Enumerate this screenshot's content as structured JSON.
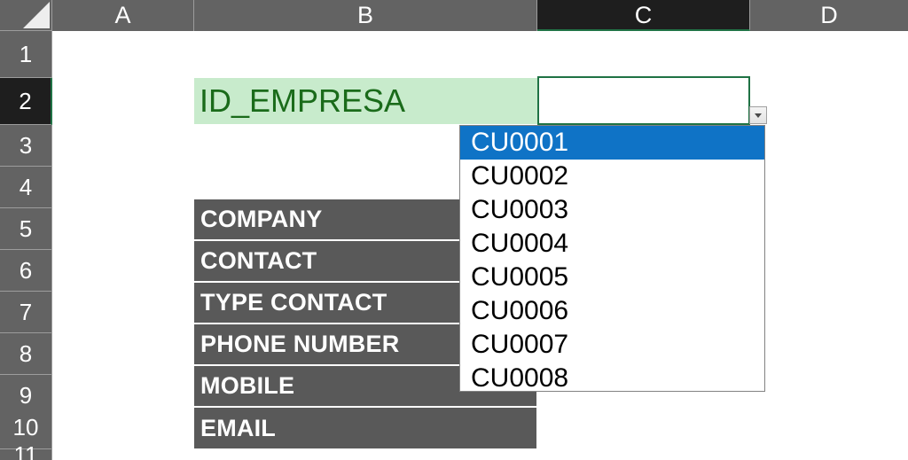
{
  "grid": {
    "columns": [
      {
        "label": "A",
        "active": false
      },
      {
        "label": "B",
        "active": false
      },
      {
        "label": "C",
        "active": true
      },
      {
        "label": "D",
        "active": false
      }
    ],
    "rows": [
      {
        "label": "1",
        "active": false
      },
      {
        "label": "2",
        "active": true
      },
      {
        "label": "3",
        "active": false
      },
      {
        "label": "4",
        "active": false
      },
      {
        "label": "5",
        "active": false
      },
      {
        "label": "6",
        "active": false
      },
      {
        "label": "7",
        "active": false
      },
      {
        "label": "8",
        "active": false
      },
      {
        "label": "9",
        "active": false
      },
      {
        "label": "10",
        "active": false
      },
      {
        "label": "11",
        "active": false
      }
    ]
  },
  "cells": {
    "title": "ID_EMPRESA",
    "selected_value": "",
    "labels": [
      "COMPANY",
      "CONTACT",
      "TYPE CONTACT",
      "PHONE NUMBER",
      "MOBILE",
      "EMAIL"
    ]
  },
  "dropdown": {
    "open": true,
    "arrow_icon": "chevron-down-icon",
    "selected_index": 0,
    "options": [
      "CU0001",
      "CU0002",
      "CU0003",
      "CU0004",
      "CU0005",
      "CU0006",
      "CU0007",
      "CU0008"
    ]
  },
  "colors": {
    "header_bg": "#636363",
    "header_active_bg": "#1e1e1e",
    "accent_green": "#217346",
    "title_cell_bg": "#c8ebcc",
    "title_cell_fg": "#1a6b1a",
    "label_cell_bg": "#595959",
    "dropdown_highlight": "#0f73c6"
  }
}
